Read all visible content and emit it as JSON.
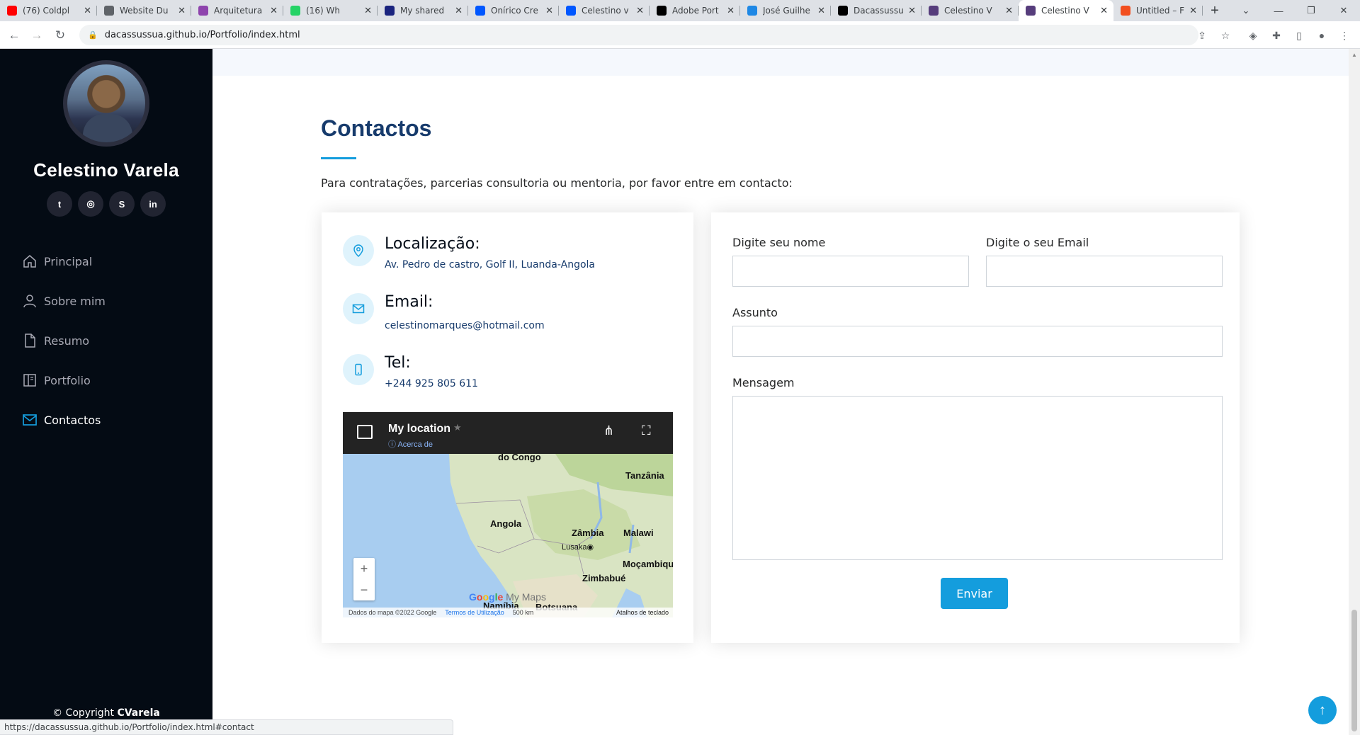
{
  "browser": {
    "tabs": [
      {
        "label": "(76) Coldpl",
        "favicon_color": "#ff0000",
        "active": false
      },
      {
        "label": "Website Du",
        "favicon_color": "#5f6368",
        "active": false
      },
      {
        "label": "Arquitetura",
        "favicon_color": "#8e44ad",
        "active": false
      },
      {
        "label": "(16) Wh",
        "favicon_color": "#25d366",
        "active": false
      },
      {
        "label": "My shared",
        "favicon_color": "#1a237e",
        "active": false
      },
      {
        "label": "Onírico Cre",
        "favicon_color": "#0057ff",
        "active": false
      },
      {
        "label": "Celestino v",
        "favicon_color": "#0057ff",
        "active": false
      },
      {
        "label": "Adobe Port",
        "favicon_color": "#000000",
        "active": false
      },
      {
        "label": "José Guilhe",
        "favicon_color": "#1e88e5",
        "active": false
      },
      {
        "label": "Dacassussu",
        "favicon_color": "#000000",
        "active": false
      },
      {
        "label": "Celestino V",
        "favicon_color": "#563d7c",
        "active": false
      },
      {
        "label": "Celestino V",
        "favicon_color": "#563d7c",
        "active": true
      },
      {
        "label": "Untitled – F",
        "favicon_color": "#f24e1e",
        "active": false
      }
    ],
    "url": "dacassussua.github.io/Portfolio/index.html",
    "status_url": "https://dacassussua.github.io/Portfolio/index.html#contact"
  },
  "sidebar": {
    "name": "Celestino Varela",
    "socials": [
      {
        "icon": "twitter-icon",
        "glyph": "t"
      },
      {
        "icon": "instagram-icon",
        "glyph": "◎"
      },
      {
        "icon": "skype-icon",
        "glyph": "S"
      },
      {
        "icon": "linkedin-icon",
        "glyph": "in"
      }
    ],
    "nav": [
      {
        "label": "Principal",
        "icon": "home-icon",
        "active": false
      },
      {
        "label": "Sobre mim",
        "icon": "person-icon",
        "active": false
      },
      {
        "label": "Resumo",
        "icon": "file-icon",
        "active": false
      },
      {
        "label": "Portfolio",
        "icon": "book-icon",
        "active": false
      },
      {
        "label": "Contactos",
        "icon": "envelope-icon",
        "active": true
      }
    ],
    "copyright_prefix": "© Copyright",
    "copyright_name": "CVarela"
  },
  "contact": {
    "title": "Contactos",
    "intro": "Para contratações, parcerias consultoria ou mentoria, por favor entre em contacto:",
    "location": {
      "title": "Localização:",
      "value": "Av. Pedro de castro, Golf II, Luanda-Angola"
    },
    "email": {
      "title": "Email:",
      "value": "celestinomarques@hotmail.com"
    },
    "phone": {
      "title": "Tel:",
      "value": "+244 925 805 611"
    }
  },
  "map": {
    "title": "My location",
    "subtitle": "Acerca de",
    "labels": [
      "do Congo",
      "Tanzânia",
      "Angola",
      "Zâmbia",
      "Malawi",
      "Lusaka",
      "Moçambiqu",
      "Zimbabué",
      "Namíbia",
      "Botsuana"
    ],
    "brand": "Google",
    "brand_suffix": "My Maps",
    "attribution": "Dados do mapa ©2022 Google",
    "terms": "Termos de Utilização",
    "scale": "500 km",
    "shortcuts": "Atalhos de teclado"
  },
  "form": {
    "name_label": "Digite seu nome",
    "email_label": "Digite o seu Email",
    "subject_label": "Assunto",
    "message_label": "Mensagem",
    "submit": "Enviar"
  },
  "colors": {
    "accent": "#149ddd",
    "heading": "#173b6c",
    "sidebar_bg": "#040b14"
  }
}
